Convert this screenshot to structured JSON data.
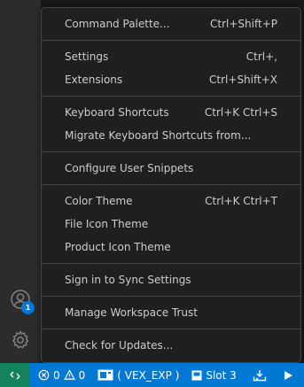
{
  "activity_bar": {
    "icons": [
      "accounts-icon",
      "manage-gear-icon"
    ],
    "accounts_badge": "1"
  },
  "menu": {
    "groups": [
      [
        {
          "label": "Command Palette...",
          "shortcut": "Ctrl+Shift+P"
        }
      ],
      [
        {
          "label": "Settings",
          "shortcut": "Ctrl+,"
        },
        {
          "label": "Extensions",
          "shortcut": "Ctrl+Shift+X"
        }
      ],
      [
        {
          "label": "Keyboard Shortcuts",
          "shortcut": "Ctrl+K Ctrl+S"
        },
        {
          "label": "Migrate Keyboard Shortcuts from...",
          "shortcut": ""
        }
      ],
      [
        {
          "label": "Configure User Snippets",
          "shortcut": ""
        }
      ],
      [
        {
          "label": "Color Theme",
          "shortcut": "Ctrl+K Ctrl+T"
        },
        {
          "label": "File Icon Theme",
          "shortcut": ""
        },
        {
          "label": "Product Icon Theme",
          "shortcut": ""
        }
      ],
      [
        {
          "label": "Sign in to Sync Settings",
          "shortcut": ""
        }
      ],
      [
        {
          "label": "Manage Workspace Trust",
          "shortcut": ""
        }
      ],
      [
        {
          "label": "Check for Updates...",
          "shortcut": ""
        }
      ]
    ]
  },
  "statusbar": {
    "remote_icon": "remote-icon",
    "errors": "0",
    "warnings": "0",
    "vex_label": "( VEX_EXP )",
    "slot_label": "Slot 3",
    "colors": {
      "background": "#0078d4",
      "remote": "#16825d"
    }
  }
}
